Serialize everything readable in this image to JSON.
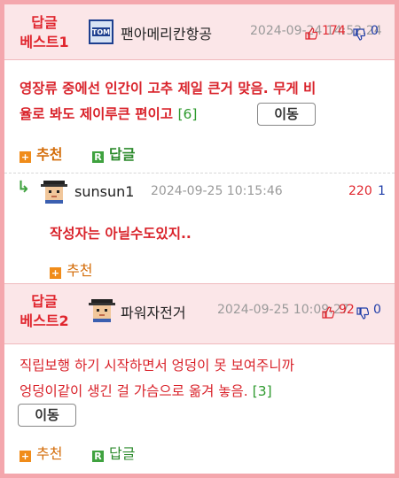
{
  "comments": [
    {
      "badge_line1": "답글",
      "badge_line2": "베스트1",
      "nickname": "팬아메리칸항공",
      "timestamp": "2024-09-24 14:52:24",
      "upvotes": "174",
      "downvotes": "0",
      "text_line1": "영장류 중에선 인간이 고추 제일 큰거 맞음. 무게 비",
      "text_line2": "율로 봐도 제이루큰 편이고",
      "reply_count": "[6]",
      "move_label": "이동",
      "recommend_label": "추천",
      "reply_label": "답글"
    },
    {
      "nickname": "sunsun1",
      "timestamp": "2024-09-25 10:15:46",
      "upvotes": "220",
      "downvotes": "1",
      "text_line1": "작성자는 아닐수도있지..",
      "recommend_label": "추천"
    },
    {
      "badge_line1": "답글",
      "badge_line2": "베스트2",
      "nickname": "파워자전거",
      "timestamp": "2024-09-25 10:09:27",
      "upvotes": "92",
      "downvotes": "0",
      "text_line1": "직립보행 하기 시작하면서 엉덩이 못 보여주니까",
      "text_line2": "엉덩이같이 생긴 걸 가슴으로 옮겨 놓음.",
      "reply_count": "[3]",
      "move_label": "이동",
      "recommend_label": "추천",
      "reply_label": "답글"
    }
  ],
  "icons": {
    "recommend": "plus-square-icon",
    "reply": "r-square-icon",
    "thumb_up": "thumbs-up-icon",
    "thumb_down": "thumbs-down-icon",
    "reply_arrow": "reply-arrow-icon"
  },
  "colors": {
    "frame_border": "#f4a7ad",
    "best_header_bg": "#fbe6e8",
    "best_label": "#e0262e",
    "upvote": "#e0262e",
    "downvote": "#1f3da8",
    "recommend": "#f08c1a",
    "reply": "#3fa23f"
  }
}
